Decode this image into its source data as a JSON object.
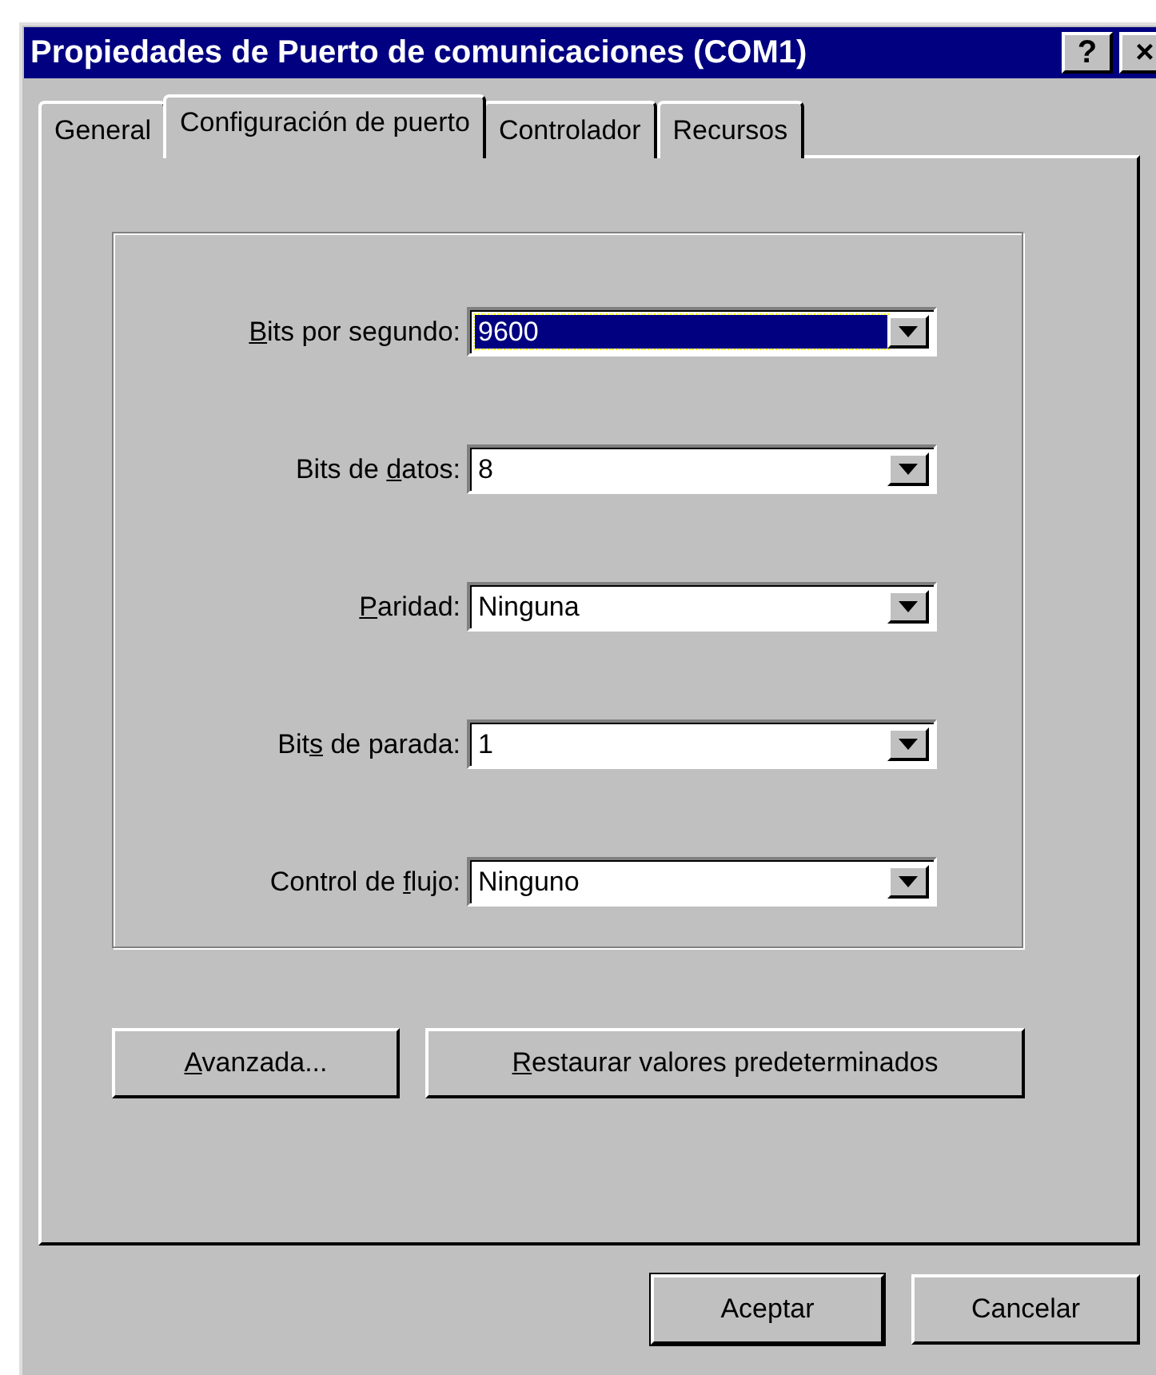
{
  "window": {
    "title": "Propiedades de Puerto de comunicaciones (COM1)",
    "controls": [
      {
        "label": "?"
      },
      {
        "label": "×"
      }
    ]
  },
  "tabs": [
    {
      "label": "General",
      "selected": false
    },
    {
      "label": "Configuración de puerto",
      "selected": true
    },
    {
      "label": "Controlador",
      "selected": false
    },
    {
      "label": "Recursos",
      "selected": false
    }
  ],
  "fields": [
    {
      "label": {
        "key": "B",
        "post": "its por segundo:"
      },
      "value": "9600",
      "focused": true
    },
    {
      "label": {
        "pre": "Bits de ",
        "key": "d",
        "post": "atos:"
      },
      "value": "8",
      "focused": false
    },
    {
      "label": {
        "key": "P",
        "post": "aridad:"
      },
      "value": "Ninguna",
      "focused": false
    },
    {
      "label": {
        "pre": "Bit",
        "key": "s",
        "post": " de parada:"
      },
      "value": "1",
      "focused": false
    },
    {
      "label": {
        "pre": "Control de ",
        "key": "f",
        "post": "lujo:"
      },
      "value": "Ninguno",
      "focused": false
    }
  ],
  "panel_buttons": [
    {
      "key": "A",
      "post": "vanzada..."
    },
    {
      "key": "R",
      "post": "estaurar valores predeterminados"
    }
  ],
  "buttons": [
    {
      "label": "Aceptar",
      "default": true
    },
    {
      "label": "Cancelar",
      "default": false
    }
  ]
}
